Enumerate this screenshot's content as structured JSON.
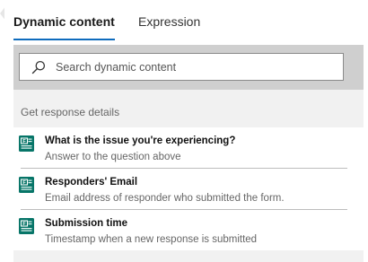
{
  "tabs": [
    {
      "label": "Dynamic content",
      "active": true
    },
    {
      "label": "Expression",
      "active": false
    }
  ],
  "search": {
    "placeholder": "Search dynamic content",
    "value": "",
    "icon": "search-icon"
  },
  "section": {
    "title": "Get response details"
  },
  "items": [
    {
      "title": "What is the issue you're experiencing?",
      "description": "Answer to the question above",
      "icon": "forms-icon"
    },
    {
      "title": "Responders' Email",
      "description": "Email address of responder who submitted the form.",
      "icon": "forms-icon"
    },
    {
      "title": "Submission time",
      "description": "Timestamp when a new response is submitted",
      "icon": "forms-icon"
    }
  ],
  "colors": {
    "accent": "#0f6cbd",
    "forms_icon": "#077568",
    "search_band": "#cfcfcf",
    "content_bg": "#f1f1f1"
  }
}
